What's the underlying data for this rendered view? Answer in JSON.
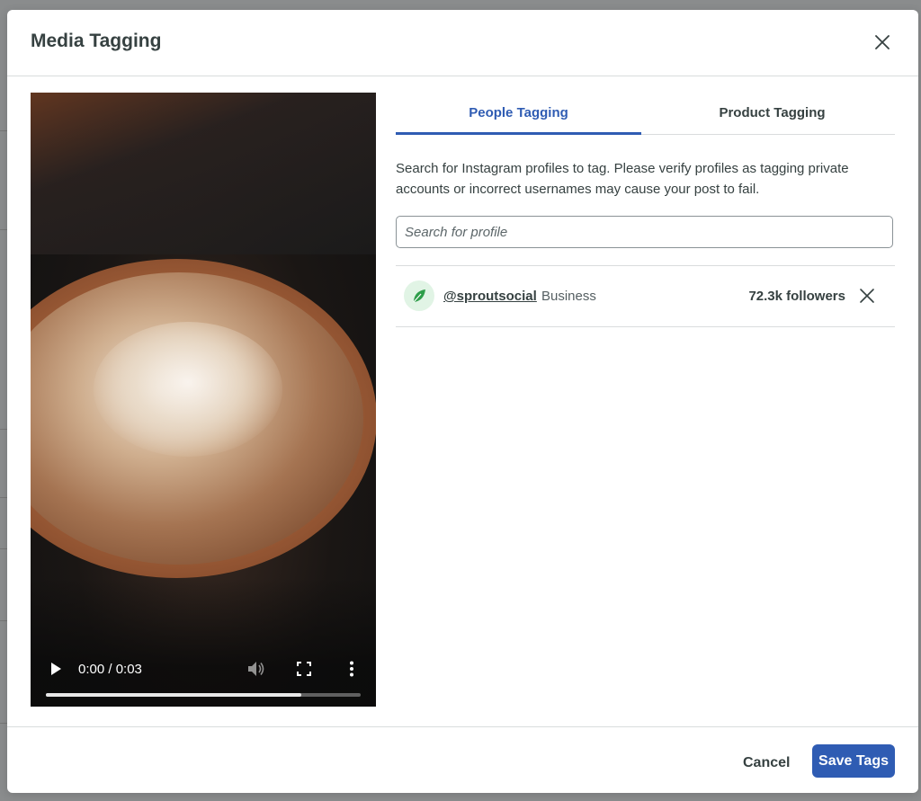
{
  "modal": {
    "title": "Media Tagging"
  },
  "video": {
    "time": "0:00 / 0:03",
    "progress": 0.81
  },
  "tabs": [
    {
      "label": "People Tagging",
      "active": true
    },
    {
      "label": "Product Tagging",
      "active": false
    }
  ],
  "description": "Search for Instagram profiles to tag. Please verify profiles as tagging private accounts or incorrect usernames may cause your post to fail.",
  "search": {
    "placeholder": "Search for profile",
    "value": ""
  },
  "tagged_profiles": [
    {
      "handle": "@sproutsocial",
      "type": "Business",
      "followers": "72.3k followers",
      "avatar_icon": "sprout-leaf-icon"
    }
  ],
  "footer": {
    "cancel_label": "Cancel",
    "save_label": "Save Tags"
  },
  "colors": {
    "accent": "#2f5cb3",
    "text": "#364141",
    "sprout_green": "#59cb59"
  }
}
